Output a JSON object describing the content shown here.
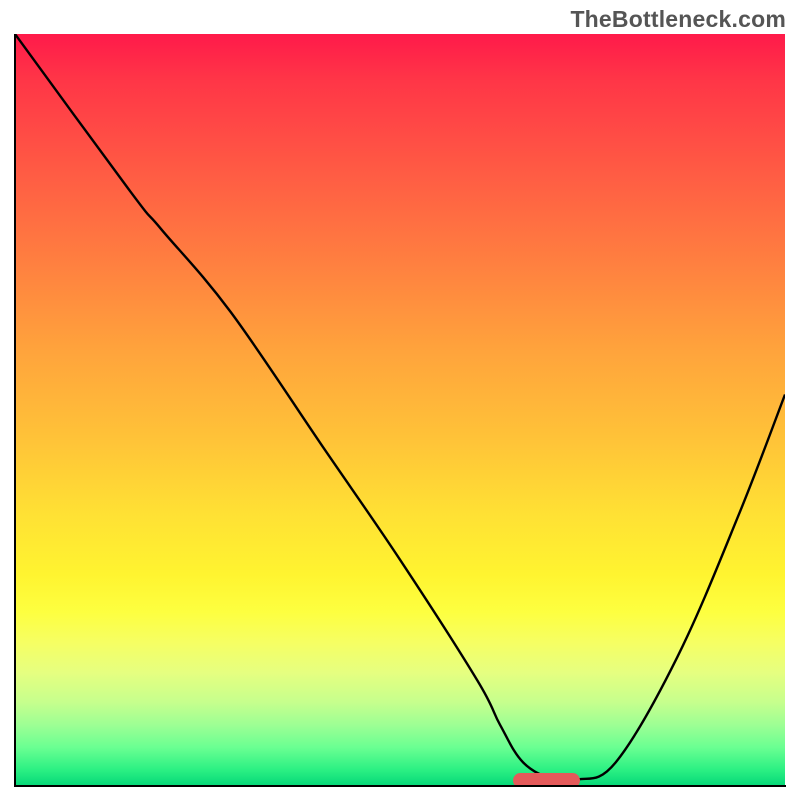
{
  "watermark": "TheBottleneck.com",
  "colors": {
    "gradient_top": "#ff1a4a",
    "gradient_bottom": "#07d979",
    "curve": "#000000",
    "bar": "#e45a5a",
    "watermark_text": "#555555"
  },
  "chart_data": {
    "type": "line",
    "title": "",
    "xlabel": "",
    "ylabel": "",
    "xlim": [
      0,
      100
    ],
    "ylim": [
      0,
      100
    ],
    "series": [
      {
        "name": "curve",
        "x": [
          0,
          15,
          19,
          28,
          40,
          50,
          60,
          63,
          66,
          70,
          73,
          78,
          86,
          94,
          100
        ],
        "values": [
          100,
          79,
          74,
          63,
          45,
          30,
          14,
          8,
          3,
          0.7,
          0.7,
          3,
          17,
          36,
          52
        ]
      }
    ],
    "annotations": [
      {
        "type": "bar",
        "x_center": 69,
        "y": 0.7,
        "width_pct": 8.7
      }
    ]
  }
}
